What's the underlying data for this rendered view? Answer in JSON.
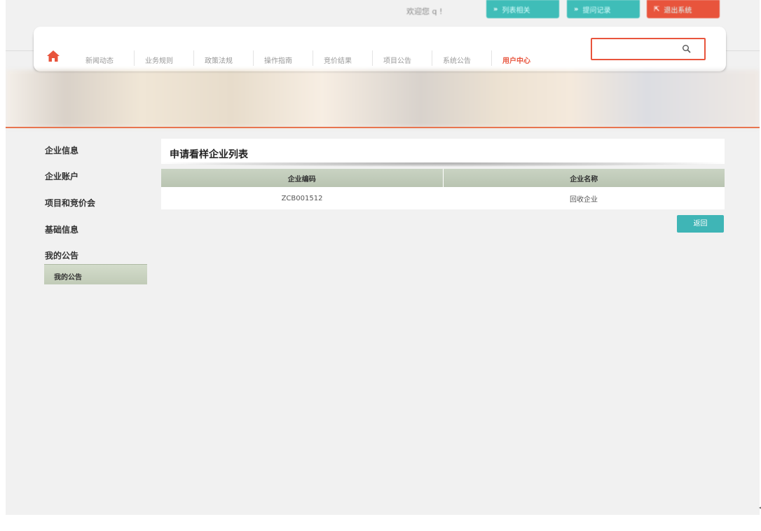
{
  "header": {
    "welcome": "欢迎您 q !",
    "buttons": [
      {
        "label": "列表相关",
        "icon": "double-chevron-icon"
      },
      {
        "label": "提问记录",
        "icon": "double-chevron-icon"
      },
      {
        "label": "退出系统",
        "icon": "exit-icon"
      }
    ]
  },
  "nav": {
    "home_icon": "home-icon",
    "items": [
      "新闻动态",
      "业务规则",
      "政策法规",
      "操作指南",
      "竞价结果",
      "项目公告",
      "系统公告",
      "用户中心"
    ],
    "active": "用户中心",
    "search": {
      "placeholder": "",
      "icon": "search-icon"
    }
  },
  "sidebar": {
    "items": [
      "企业信息",
      "企业账户",
      "项目和竞价会",
      "基础信息",
      "我的公告"
    ],
    "sub_item": "我的公告"
  },
  "main": {
    "title": "申请看样企业列表",
    "table": {
      "columns": [
        "企业编码",
        "企业名称"
      ],
      "rows": [
        [
          "ZCB001512",
          "回收企业"
        ]
      ]
    },
    "back_button": "返回"
  },
  "colors": {
    "accent": "#e8543c",
    "teal": "#3fb5b6",
    "header_row": "#c4cebd"
  }
}
